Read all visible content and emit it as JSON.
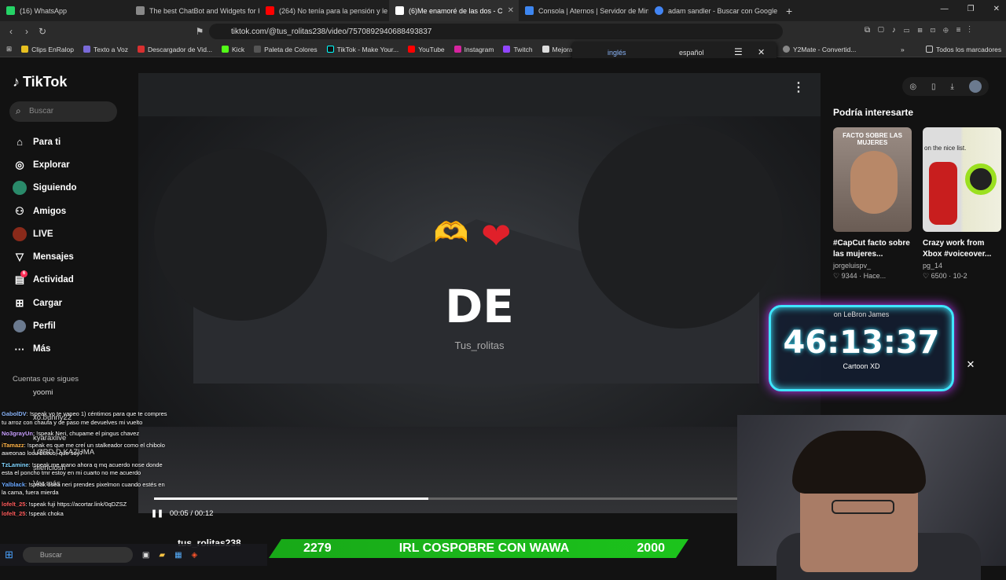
{
  "tabs": [
    {
      "title": "(16) WhatsApp",
      "color": "#25d366"
    },
    {
      "title": "The best ChatBot and Widgets for Ki",
      "color": "#888888"
    },
    {
      "title": "(264) No tenía para la pensión y le c",
      "color": "#ff0000"
    },
    {
      "title": "(6)Me enamoré de las dos - C",
      "color": "#ffffff",
      "active": true
    },
    {
      "title": "Consola | Aternos | Servidor de Mine",
      "color": "#3d86f0"
    },
    {
      "title": "adam sandler - Buscar con Google",
      "color": "#4285f4"
    }
  ],
  "address": {
    "url": "tiktok.com/@tus_rolitas238/video/7570892940688493837"
  },
  "bookmarks": [
    "Clips EnRalop",
    "Texto a Voz",
    "Descargador de Vid...",
    "Kick",
    "Paleta de Colores",
    "TikTok - Make Your...",
    "YouTube",
    "Instagram",
    "Twitch",
    "Mejorar Im"
  ],
  "bookmarks_right": [
    "Y2Mate - Convertid...",
    "Todos los marcadores"
  ],
  "translate": {
    "lang1": "inglés",
    "lang2": "español"
  },
  "tiktok": {
    "logo": "TikTok",
    "search_placeholder": "Buscar",
    "nav": [
      {
        "label": "Para ti",
        "icon": "home-icon"
      },
      {
        "label": "Explorar",
        "icon": "compass-icon"
      },
      {
        "label": "Siguiendo",
        "icon": "following-icon"
      },
      {
        "label": "Amigos",
        "icon": "friends-icon"
      },
      {
        "label": "LIVE",
        "icon": "live-icon"
      },
      {
        "label": "Mensajes",
        "icon": "messages-icon"
      },
      {
        "label": "Actividad",
        "icon": "activity-icon",
        "badge": "6"
      },
      {
        "label": "Cargar",
        "icon": "upload-icon"
      },
      {
        "label": "Perfil",
        "icon": "profile-icon"
      },
      {
        "label": "Más",
        "icon": "more-icon"
      }
    ],
    "following_heading": "Cuentas que sigues",
    "following": [
      "yoomi",
      "xo.bunny22",
      "kyaraxlive",
      "LØRD.D.KAZUMA",
      "silenciosh",
      "Ver más"
    ]
  },
  "video": {
    "big_text": "DE",
    "watermark": "Tus_rolitas",
    "time": "00:05 / 00:12",
    "progress": 0.47,
    "author": "tus_rolitas238"
  },
  "recommendations": {
    "title": "Podría interesarte",
    "cards": [
      {
        "caption": "#CapCut facto sobre las mujeres...",
        "user": "jorgeluispv_",
        "stats": "9344 · Hace...",
        "thumb_text": "FACTO SOBRE LAS MUJERES"
      },
      {
        "caption": "Crazy work from Xbox #voiceover...",
        "user": "pg_14",
        "stats": "6500 · 10-2",
        "thumb_text": "on the nice list."
      }
    ]
  },
  "overlay": {
    "label": "on LeBron James",
    "time": "46:13:37",
    "footer": "Cartoon XD"
  },
  "chat": [
    {
      "user": "GabolDV",
      "msg": ": !speak yo te yapeo 1) céntimos para que te compres tu arroz con chaufa y de paso me devuelves mi vuelto"
    },
    {
      "user": "No3grayUn",
      "msg": ": !speak Neri, chupame el pingus chavez"
    },
    {
      "user": "iTamazz",
      "msg": ": !speak es que me creí un stalkeador como el chibolo aweonao locu bueco, que soy?"
    },
    {
      "user": "TzLamine",
      "msg": ": !speak me mano ahora q mq acuerdo nose donde esta el poncho tmr estoy en mi cuarto no me acuerdo"
    },
    {
      "user": "Yalblack",
      "msg": ": !speak osea neri prendes pixelmon cuando estés en la cama, fuera mierda"
    },
    {
      "user": "lofelt_25",
      "msg": ": !speak fuji https://acortar.link/0qDZSZ"
    },
    {
      "user": "lofelt_25",
      "msg": ": !speak choka"
    }
  ],
  "banner": {
    "left": "2279",
    "title": "IRL COSPOBRE CON WAWA",
    "right": "2000"
  },
  "taskbar": {
    "search": "Buscar"
  }
}
